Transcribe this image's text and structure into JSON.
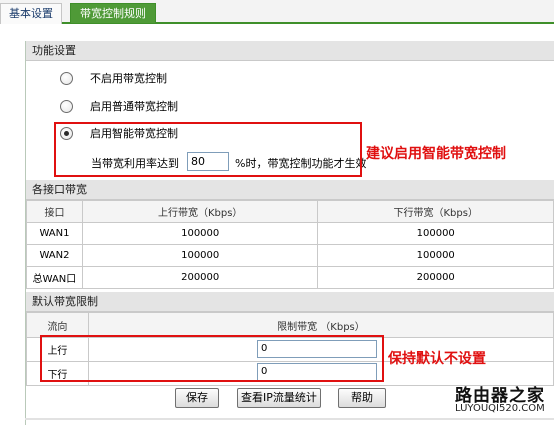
{
  "tabs": [
    {
      "label": "基本设置"
    },
    {
      "label": "带宽控制规则"
    }
  ],
  "feature_settings": {
    "header": "功能设置",
    "options": [
      {
        "label": "不启用带宽控制",
        "checked": false
      },
      {
        "label": "启用普通带宽控制",
        "checked": false
      },
      {
        "label": "启用智能带宽控制",
        "checked": true
      }
    ],
    "threshold_label": "当带宽利用率达到",
    "threshold_value": "80",
    "threshold_suffix": "%时，带宽控制功能才生效",
    "note": "建议启用智能带宽控制"
  },
  "interface_bandwidth": {
    "header": "各接口带宽",
    "columns": [
      "接口",
      "上行带宽（Kbps）",
      "下行带宽（Kbps）"
    ],
    "rows": [
      [
        "WAN1",
        "100000",
        "100000"
      ],
      [
        "WAN2",
        "100000",
        "100000"
      ],
      [
        "总WAN口",
        "200000",
        "200000"
      ]
    ]
  },
  "default_limit": {
    "header": "默认带宽限制",
    "columns": [
      "流向",
      "限制带宽 （Kbps）"
    ],
    "rows": [
      {
        "direction": "上行",
        "value": "0"
      },
      {
        "direction": "下行",
        "value": "0"
      }
    ],
    "note": "保持默认不设置"
  },
  "buttons": {
    "save": "保存",
    "ip_stats": "查看IP流量统计",
    "help": "帮助"
  },
  "watermark": {
    "brand": "路由器之家",
    "url": "LUYOUQI520.COM"
  },
  "colors": {
    "active_tab": "#4f9a37",
    "annotation_red": "#e01010",
    "section_header_bg": "#e4e4e4"
  }
}
